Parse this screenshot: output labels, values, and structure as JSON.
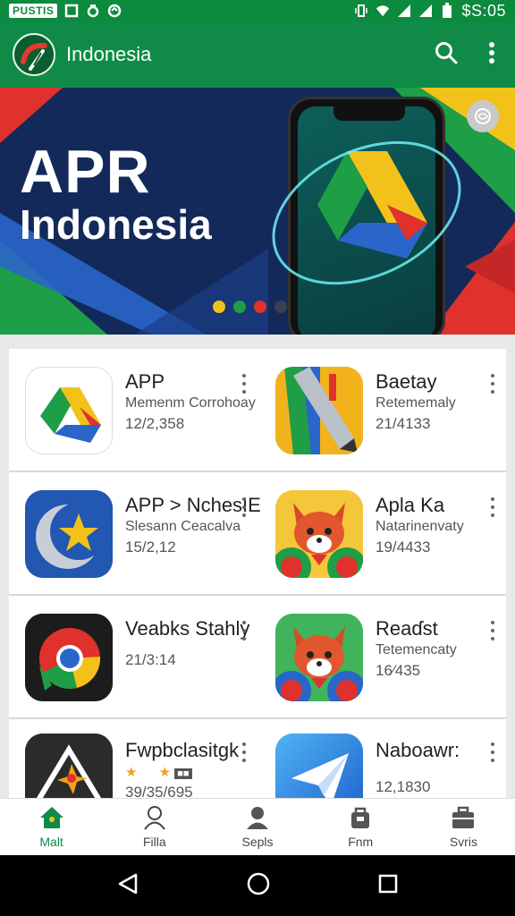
{
  "status_bar": {
    "carrier": "PUSTIS",
    "time": "$S:05"
  },
  "app_bar": {
    "title": "Indonesia",
    "search_icon": "search-icon",
    "menu_icon": "more-vert-icon"
  },
  "banner": {
    "title": "APR",
    "subtitle": "Indonesia",
    "dot_colors": [
      "#f2c21b",
      "#1e9e46",
      "#e0312c",
      "#3b3f53"
    ]
  },
  "apps": [
    [
      {
        "name": "APP",
        "developer": "Memenm Corrohoay",
        "meta": "12/2,358",
        "icon": "drive-icon"
      },
      {
        "name": "Baetay",
        "developer": "Retememaly",
        "meta": "21/4133",
        "icon": "pencil-icon"
      }
    ],
    [
      {
        "name": "APP > NchesIE",
        "developer": "Slesann Ceacalva",
        "meta": "15/2,12",
        "icon": "crescent-star-icon"
      },
      {
        "name": "Apla Ka",
        "developer": "Natarinenvaty",
        "meta": "19/4433",
        "icon": "fox-icon"
      }
    ],
    [
      {
        "name": "Veabks Stahly",
        "developer": "",
        "meta": "21/3:14",
        "icon": "chrome-icon"
      },
      {
        "name": "Reaɗst",
        "developer": "Tetemencaty",
        "meta": "16⁄435",
        "icon": "fox-icon"
      }
    ],
    [
      {
        "name": "Fwpbclasitgk",
        "developer": "",
        "meta": "39/35/695",
        "icon": "warning-icon"
      },
      {
        "name": "Naboawr:",
        "developer": "",
        "meta": "12,1830",
        "icon": "paper-plane-icon"
      }
    ]
  ],
  "bottom_nav": [
    {
      "label": "Malt",
      "icon": "home-icon"
    },
    {
      "label": "Filla",
      "icon": "person-icon"
    },
    {
      "label": "Sepls",
      "icon": "account-icon"
    },
    {
      "label": "Fnm",
      "icon": "bag-icon"
    },
    {
      "label": "Svris",
      "icon": "briefcase-icon"
    }
  ],
  "colors": {
    "primary": "#0f8b47",
    "status_bar": "#0c8a3e",
    "banner_bg": "#112a57"
  }
}
